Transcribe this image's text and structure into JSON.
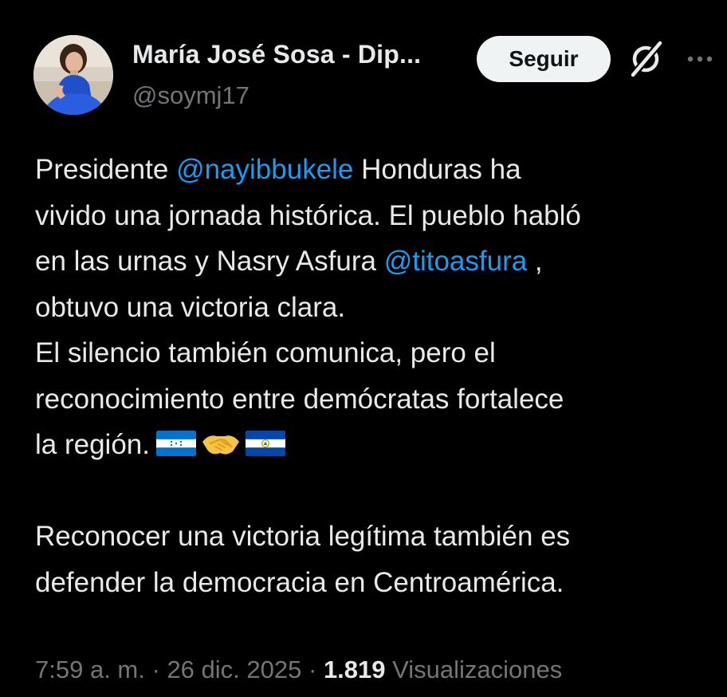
{
  "author": {
    "name": "María José Sosa - Dip...",
    "handle": "@soymj17"
  },
  "actions": {
    "follow_label": "Seguir",
    "icons": [
      "grok-icon",
      "more-options-icon"
    ]
  },
  "tweet": {
    "lines": [
      {
        "before": "Presidente ",
        "mention": "@nayibbukele",
        "after": " Honduras ha"
      },
      {
        "text": "vivido una jornada histórica. El pueblo habló"
      },
      {
        "before": "en las urnas y Nasry Asfura ",
        "mention": "@titoasfura",
        "after": " ,"
      },
      {
        "text": "obtuvo una victoria clara."
      },
      {
        "text": "El silencio también comunica, pero el"
      },
      {
        "text": "reconocimiento entre demócratas fortalece"
      },
      {
        "text": "la región."
      },
      {
        "text": "Reconocer una victoria legítima también es"
      },
      {
        "text": "defender la democracia en Centroamérica."
      }
    ],
    "emojis": [
      "flag-honduras",
      "handshake",
      "flag-el-salvador"
    ]
  },
  "meta": {
    "time": "7:59 a. m.",
    "separator": "·",
    "date": "26 dic. 2025",
    "views_count": "1.819",
    "views_label": "Visualizaciones"
  },
  "colors": {
    "background": "#000000",
    "text": "#e7e9ea",
    "secondary": "#71767b",
    "link": "#1d9bf0",
    "button_bg": "#eff3f4",
    "honduras_blue": "#0073cf",
    "el_salvador_blue": "#0047ab"
  }
}
